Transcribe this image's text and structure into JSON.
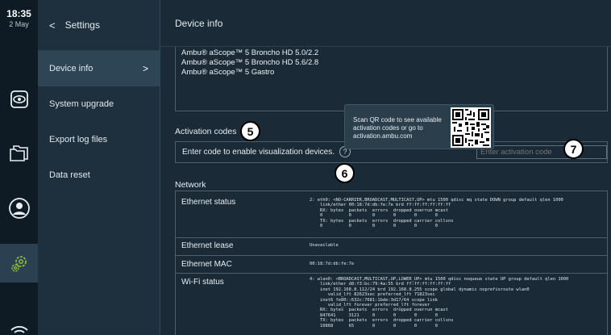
{
  "status": {
    "time": "18:35",
    "date": "2 May"
  },
  "rail": {
    "items": [
      {
        "name": "live-view",
        "icon": "eye-icon"
      },
      {
        "name": "files",
        "icon": "folders-icon"
      },
      {
        "name": "user",
        "icon": "user-icon"
      },
      {
        "name": "settings",
        "icon": "gear-icon",
        "active": true
      },
      {
        "name": "wifi",
        "icon": "wifi-icon"
      }
    ]
  },
  "settings": {
    "back_glyph": "<",
    "title": "Settings",
    "menu": [
      {
        "label": "Device info",
        "selected": true,
        "chevron": ">"
      },
      {
        "label": "System upgrade"
      },
      {
        "label": "Export log files"
      },
      {
        "label": "Data reset"
      }
    ]
  },
  "main": {
    "title": "Device info",
    "devices": [
      "Ambu® aScope™ 5 Broncho HD 5.0/2.2",
      "Ambu® aScope™ 5 Broncho HD 5.6/2.8",
      "Ambu® aScope™ 5 Gastro"
    ],
    "activation": {
      "label": "Activation codes",
      "prompt": "Enter code to enable visualization devices.",
      "help_glyph": "?",
      "placeholder": "Enter activation code",
      "tooltip": "Scan QR code to see available activation codes or go to activation.ambu.com"
    },
    "callouts": {
      "five": "5",
      "six": "6",
      "seven": "7"
    },
    "network": {
      "label": "Network",
      "rows": [
        {
          "key": "Ethernet status",
          "value": "2: eth0: <NO-CARRIER,BROADCAST,MULTICAST,UP> mtu 1500 qdisc mq state DOWN group default qlen 1000\n    link/ether 00:18:7d:db:fe:7e brd ff:ff:ff:ff:ff:ff\n    RX: bytes  packets  errors  dropped overrun mcast\n    0          0        0       0       0       0\n    TX: bytes  packets  errors  dropped carrier collsns\n    0          0        0       0       0       0"
        },
        {
          "key": "Ethernet lease",
          "value": "Unavailable"
        },
        {
          "key": "Ethernet MAC",
          "value": "00:18:7d:db:fe:7e"
        },
        {
          "key": "Wi-Fi status",
          "value": "4: wlan0: <BROADCAST,MULTICAST,UP,LOWER_UP> mtu 1500 qdisc noqueue state UP group default qlen 1000\n    link/ether d8:f3:bc:79:4a:55 brd ff:ff:ff:ff:ff:ff\n    inet 192.168.8.112/24 brd 192.168.8.255 scope global dynamic noprefixroute wlan0\n       valid_lft 82623sec preferred_lft 71823sec\n    inet6 fe80::632c:7681:1bde:3d17/64 scope link\n       valid_lft forever preferred_lft forever\n    RX: bytes  packets  errors  dropped overrun mcast\n    847641     3121     0       0       0       0\n    TX: bytes  packets  errors  dropped carrier collsns\n    10868      65       0       0       0       0"
        }
      ]
    }
  },
  "colors": {
    "rail_bg": "#0e1a24",
    "panel_bg": "#1e303d",
    "main_bg": "#1a2a36",
    "selected_bg": "#2e4556"
  }
}
